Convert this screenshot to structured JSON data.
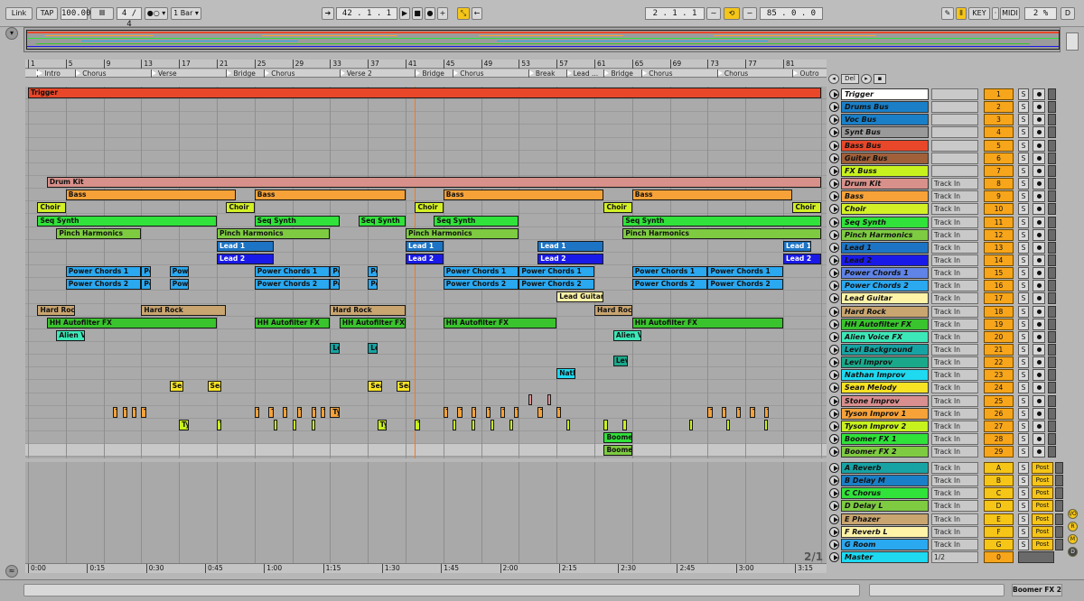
{
  "transport": {
    "link": "Link",
    "tap": "TAP",
    "tempo": "100.00",
    "sig": "4 / 4",
    "quant": "1 Bar",
    "position": "42 .   1 .   1",
    "loop_start": "2 .   1 .   1",
    "loop_len": "85 .   0 .   0",
    "key": "KEY",
    "midi": "MIDI",
    "cpu": "2 %",
    "d": "D"
  },
  "ruler": [
    {
      "label": "1",
      "bar": 1
    },
    {
      "label": "5",
      "bar": 5
    },
    {
      "label": "9",
      "bar": 9
    },
    {
      "label": "13",
      "bar": 13
    },
    {
      "label": "17",
      "bar": 17
    },
    {
      "label": "21",
      "bar": 21
    },
    {
      "label": "25",
      "bar": 25
    },
    {
      "label": "29",
      "bar": 29
    },
    {
      "label": "33",
      "bar": 33
    },
    {
      "label": "37",
      "bar": 37
    },
    {
      "label": "41",
      "bar": 41
    },
    {
      "label": "45",
      "bar": 45
    },
    {
      "label": "49",
      "bar": 49
    },
    {
      "label": "53",
      "bar": 53
    },
    {
      "label": "57",
      "bar": 57
    },
    {
      "label": "61",
      "bar": 61
    },
    {
      "label": "65",
      "bar": 65
    },
    {
      "label": "69",
      "bar": 69
    },
    {
      "label": "73",
      "bar": 73
    },
    {
      "label": "77",
      "bar": 77
    },
    {
      "label": "81",
      "bar": 81
    }
  ],
  "locators": [
    {
      "label": "Intro",
      "bar": 2
    },
    {
      "label": "Chorus",
      "bar": 6
    },
    {
      "label": "Verse",
      "bar": 14
    },
    {
      "label": "Bridge",
      "bar": 22
    },
    {
      "label": "Chorus",
      "bar": 26
    },
    {
      "label": "Verse 2",
      "bar": 34
    },
    {
      "label": "Bridge",
      "bar": 42
    },
    {
      "label": "Chorus",
      "bar": 46
    },
    {
      "label": "Break",
      "bar": 54
    },
    {
      "label": "Lead ...",
      "bar": 58
    },
    {
      "label": "Bridge",
      "bar": 62
    },
    {
      "label": "Chorus",
      "bar": 66
    },
    {
      "label": "Chorus",
      "bar": 74
    },
    {
      "label": "Outro",
      "bar": 82
    }
  ],
  "time_ticks": [
    {
      "label": "0:00",
      "bar": 1
    },
    {
      "label": "0:15",
      "bar": 7.25
    },
    {
      "label": "0:30",
      "bar": 13.5
    },
    {
      "label": "0:45",
      "bar": 19.75
    },
    {
      "label": "1:00",
      "bar": 26
    },
    {
      "label": "1:15",
      "bar": 32.25
    },
    {
      "label": "1:30",
      "bar": 38.5
    },
    {
      "label": "1:45",
      "bar": 44.75
    },
    {
      "label": "2:00",
      "bar": 51
    },
    {
      "label": "2:15",
      "bar": 57.25
    },
    {
      "label": "2:30",
      "bar": 63.5
    },
    {
      "label": "2:45",
      "bar": 69.75
    },
    {
      "label": "3:00",
      "bar": 76
    },
    {
      "label": "3:15",
      "bar": 82.25
    }
  ],
  "zoom_label": "2/1",
  "tracks": [
    {
      "name": "Trigger",
      "color": "#ffffff",
      "clip_color": "#e8472a",
      "input": "",
      "num": "1"
    },
    {
      "name": "Drums Bus",
      "color": "#1a7fc7",
      "clip_color": "#1a7fc7",
      "input": "",
      "num": "2"
    },
    {
      "name": "Voc Bus",
      "color": "#1a7fc7",
      "clip_color": "#1a7fc7",
      "input": "",
      "num": "3"
    },
    {
      "name": "Synt Bus",
      "color": "#9a9a9a",
      "clip_color": "#9a9a9a",
      "input": "",
      "num": "4"
    },
    {
      "name": "Bass Bus",
      "color": "#e8472a",
      "clip_color": "#e8472a",
      "input": "",
      "num": "5"
    },
    {
      "name": "Guitar Bus",
      "color": "#a0603a",
      "clip_color": "#a0603a",
      "input": "",
      "num": "6"
    },
    {
      "name": "FX Buss",
      "color": "#c8f21e",
      "clip_color": "#c8f21e",
      "input": "",
      "num": "7"
    },
    {
      "name": "Drum Kit",
      "color": "#d8908a",
      "clip_color": "#d8908a",
      "input": "Track In",
      "num": "8"
    },
    {
      "name": "Bass",
      "color": "#f7a239",
      "clip_color": "#f7a239",
      "input": "Track In",
      "num": "9"
    },
    {
      "name": "Choir",
      "color": "#d3f026",
      "clip_color": "#d3f026",
      "input": "Track In",
      "num": "10"
    },
    {
      "name": "Seq Synth",
      "color": "#30e23a",
      "clip_color": "#30e23a",
      "input": "Track In",
      "num": "11"
    },
    {
      "name": "Pinch Harmonics",
      "color": "#7ecb42",
      "clip_color": "#7ecb42",
      "input": "Track In",
      "num": "12"
    },
    {
      "name": "Lead 1",
      "color": "#1d74c4",
      "clip_color": "#1d74c4",
      "input": "Track In",
      "num": "13"
    },
    {
      "name": "Lead 2",
      "color": "#1a1ae8",
      "clip_color": "#1a1ae8",
      "input": "Track In",
      "num": "14"
    },
    {
      "name": "Power Chords 1",
      "color": "#5f83e6",
      "clip_color": "#2aa8f0",
      "input": "Track In",
      "num": "15"
    },
    {
      "name": "Power Chords 2",
      "color": "#2aa8f0",
      "clip_color": "#2aa8f0",
      "input": "Track In",
      "num": "16"
    },
    {
      "name": "Lead Guitar",
      "color": "#fff3a8",
      "clip_color": "#fff3a8",
      "input": "Track In",
      "num": "17"
    },
    {
      "name": "Hard Rock",
      "color": "#c9a570",
      "clip_color": "#c9a570",
      "input": "Track In",
      "num": "18"
    },
    {
      "name": "HH Autofilter FX",
      "color": "#39c42d",
      "clip_color": "#39c42d",
      "input": "Track In",
      "num": "19"
    },
    {
      "name": "Alien Voice FX",
      "color": "#3de8b8",
      "clip_color": "#3de8b8",
      "input": "Track In",
      "num": "20"
    },
    {
      "name": "Levi Background",
      "color": "#17a3a3",
      "clip_color": "#17a3a3",
      "input": "Track In",
      "num": "21"
    },
    {
      "name": "Levi Improv",
      "color": "#1aa88a",
      "clip_color": "#1aa88a",
      "input": "Track In",
      "num": "22"
    },
    {
      "name": "Nathan Improv",
      "color": "#1ed9f0",
      "clip_color": "#1ed9f0",
      "input": "Track In",
      "num": "23"
    },
    {
      "name": "Sean Melody",
      "color": "#f7e224",
      "clip_color": "#f7e224",
      "input": "Track In",
      "num": "24"
    },
    {
      "name": "Stone Improv",
      "color": "#d98f8f",
      "clip_color": "#d98f8f",
      "input": "Track In",
      "num": "25"
    },
    {
      "name": "Tyson Improv 1",
      "color": "#f7a239",
      "clip_color": "#f7a239",
      "input": "Track In",
      "num": "26"
    },
    {
      "name": "Tyson Improv 2",
      "color": "#c8f21e",
      "clip_color": "#c8f21e",
      "input": "Track In",
      "num": "27"
    },
    {
      "name": "Boomer FX 1",
      "color": "#30e23a",
      "clip_color": "#30e23a",
      "input": "Track In",
      "num": "28"
    },
    {
      "name": "Boomer FX 2",
      "color": "#7ecb42",
      "clip_color": "#7ecb42",
      "input": "Track In",
      "num": "29"
    }
  ],
  "clips": [
    {
      "t": 0,
      "s": 1,
      "e": 85,
      "n": "Trigger"
    },
    {
      "t": 7,
      "s": 3,
      "e": 85,
      "n": "Drum Kit"
    },
    {
      "t": 8,
      "s": 5,
      "e": 23,
      "n": "Bass"
    },
    {
      "t": 8,
      "s": 25,
      "e": 41,
      "n": "Bass"
    },
    {
      "t": 8,
      "s": 45,
      "e": 62,
      "n": "Bass"
    },
    {
      "t": 8,
      "s": 65,
      "e": 82,
      "n": "Bass"
    },
    {
      "t": 9,
      "s": 2,
      "e": 5,
      "n": "Choir"
    },
    {
      "t": 9,
      "s": 22,
      "e": 25,
      "n": "Choir"
    },
    {
      "t": 9,
      "s": 42,
      "e": 45,
      "n": "Choir"
    },
    {
      "t": 9,
      "s": 62,
      "e": 65,
      "n": "Choir"
    },
    {
      "t": 9,
      "s": 82,
      "e": 85,
      "n": "Choir"
    },
    {
      "t": 10,
      "s": 2,
      "e": 21,
      "n": "Seq Synth"
    },
    {
      "t": 10,
      "s": 25,
      "e": 34,
      "n": "Seq Synth"
    },
    {
      "t": 10,
      "s": 36,
      "e": 41,
      "n": "Seq Synth"
    },
    {
      "t": 10,
      "s": 44,
      "e": 53,
      "n": "Seq Synth"
    },
    {
      "t": 10,
      "s": 64,
      "e": 85,
      "n": "Seq Synth"
    },
    {
      "t": 11,
      "s": 4,
      "e": 13,
      "n": "Pinch Harmonics"
    },
    {
      "t": 11,
      "s": 21,
      "e": 33,
      "n": "Pinch Harmonics"
    },
    {
      "t": 11,
      "s": 41,
      "e": 53,
      "n": "Pinch Harmonics"
    },
    {
      "t": 11,
      "s": 64,
      "e": 85,
      "n": "Pinch Harmonics"
    },
    {
      "t": 12,
      "s": 21,
      "e": 27,
      "n": "Lead 1"
    },
    {
      "t": 12,
      "s": 41,
      "e": 45,
      "n": "Lead 1"
    },
    {
      "t": 12,
      "s": 55,
      "e": 62,
      "n": "Lead 1"
    },
    {
      "t": 12,
      "s": 81,
      "e": 84,
      "n": "Lead 1"
    },
    {
      "t": 13,
      "s": 21,
      "e": 27,
      "n": "Lead 2"
    },
    {
      "t": 13,
      "s": 41,
      "e": 45,
      "n": "Lead 2"
    },
    {
      "t": 13,
      "s": 55,
      "e": 62,
      "n": "Lead 2"
    },
    {
      "t": 13,
      "s": 81,
      "e": 85,
      "n": "Lead 2"
    },
    {
      "t": 14,
      "s": 5,
      "e": 13,
      "n": "Power Chords 1"
    },
    {
      "t": 14,
      "s": 13,
      "e": 14,
      "n": "Po"
    },
    {
      "t": 14,
      "s": 16,
      "e": 18,
      "n": "Powe"
    },
    {
      "t": 14,
      "s": 25,
      "e": 33,
      "n": "Power Chords 1"
    },
    {
      "t": 14,
      "s": 33,
      "e": 34,
      "n": "Po"
    },
    {
      "t": 14,
      "s": 37,
      "e": 38,
      "n": "Po"
    },
    {
      "t": 14,
      "s": 45,
      "e": 53,
      "n": "Power Chords 1"
    },
    {
      "t": 14,
      "s": 53,
      "e": 61,
      "n": "Power Chords 1"
    },
    {
      "t": 14,
      "s": 65,
      "e": 73,
      "n": "Power Chords 1"
    },
    {
      "t": 14,
      "s": 73,
      "e": 81,
      "n": "Power Chords 1"
    },
    {
      "t": 15,
      "s": 5,
      "e": 13,
      "n": "Power Chords 2"
    },
    {
      "t": 15,
      "s": 13,
      "e": 14,
      "n": "Po"
    },
    {
      "t": 15,
      "s": 16,
      "e": 18,
      "n": "Powe"
    },
    {
      "t": 15,
      "s": 25,
      "e": 33,
      "n": "Power Chords 2"
    },
    {
      "t": 15,
      "s": 33,
      "e": 34,
      "n": "Po"
    },
    {
      "t": 15,
      "s": 37,
      "e": 38,
      "n": "Po"
    },
    {
      "t": 15,
      "s": 45,
      "e": 53,
      "n": "Power Chords 2"
    },
    {
      "t": 15,
      "s": 53,
      "e": 61,
      "n": "Power Chords 2"
    },
    {
      "t": 15,
      "s": 65,
      "e": 73,
      "n": "Power Chords 2"
    },
    {
      "t": 15,
      "s": 73,
      "e": 81,
      "n": "Power Chords 2"
    },
    {
      "t": 16,
      "s": 57,
      "e": 62,
      "n": "Lead Guitar"
    },
    {
      "t": 17,
      "s": 2,
      "e": 6,
      "n": "Hard Rock"
    },
    {
      "t": 17,
      "s": 13,
      "e": 22,
      "n": "Hard Rock"
    },
    {
      "t": 17,
      "s": 33,
      "e": 41,
      "n": "Hard Rock"
    },
    {
      "t": 17,
      "s": 61,
      "e": 65,
      "n": "Hard Rock"
    },
    {
      "t": 18,
      "s": 3,
      "e": 21,
      "n": "HH Autofilter FX"
    },
    {
      "t": 18,
      "s": 25,
      "e": 33,
      "n": "HH Autofilter FX"
    },
    {
      "t": 18,
      "s": 34,
      "e": 41,
      "n": "HH Autofilter FX"
    },
    {
      "t": 18,
      "s": 45,
      "e": 57,
      "n": "HH Autofilter FX"
    },
    {
      "t": 18,
      "s": 65,
      "e": 81,
      "n": "HH Autofilter FX"
    },
    {
      "t": 19,
      "s": 4,
      "e": 7,
      "n": "Alien Vo"
    },
    {
      "t": 19,
      "s": 63,
      "e": 66,
      "n": "Alien Vo"
    },
    {
      "t": 20,
      "s": 33,
      "e": 34,
      "n": "Le"
    },
    {
      "t": 20,
      "s": 37,
      "e": 38,
      "n": "Le"
    },
    {
      "t": 21,
      "s": 63,
      "e": 64.5,
      "n": "Levi"
    },
    {
      "t": 22,
      "s": 57,
      "e": 59,
      "n": "Nathu"
    },
    {
      "t": 23,
      "s": 16,
      "e": 17.5,
      "n": "Sear"
    },
    {
      "t": 23,
      "s": 20,
      "e": 21.5,
      "n": "Sear"
    },
    {
      "t": 23,
      "s": 37,
      "e": 38.5,
      "n": "Sear"
    },
    {
      "t": 23,
      "s": 40,
      "e": 41.5,
      "n": "Sear"
    },
    {
      "t": 24,
      "s": 54,
      "e": 54.3,
      "n": ""
    },
    {
      "t": 24,
      "s": 56,
      "e": 56.4,
      "n": ""
    },
    {
      "t": 25,
      "s": 10,
      "e": 10.5,
      "n": "T"
    },
    {
      "t": 25,
      "s": 11,
      "e": 11.5,
      "n": "T"
    },
    {
      "t": 25,
      "s": 12,
      "e": 12.5,
      "n": "T"
    },
    {
      "t": 25,
      "s": 13,
      "e": 13.5,
      "n": "T"
    },
    {
      "t": 25,
      "s": 25,
      "e": 25.5,
      "n": "T"
    },
    {
      "t": 25,
      "s": 26.5,
      "e": 27,
      "n": "T"
    },
    {
      "t": 25,
      "s": 28,
      "e": 28.5,
      "n": "T"
    },
    {
      "t": 25,
      "s": 29.5,
      "e": 30,
      "n": "T"
    },
    {
      "t": 25,
      "s": 31,
      "e": 31.5,
      "n": "T"
    },
    {
      "t": 25,
      "s": 32,
      "e": 32.5,
      "n": "T"
    },
    {
      "t": 25,
      "s": 33,
      "e": 34,
      "n": "Ty"
    },
    {
      "t": 25,
      "s": 45,
      "e": 45.5,
      "n": "T"
    },
    {
      "t": 25,
      "s": 46.5,
      "e": 47,
      "n": "T"
    },
    {
      "t": 25,
      "s": 48,
      "e": 48.5,
      "n": "T"
    },
    {
      "t": 25,
      "s": 49.5,
      "e": 50,
      "n": "T"
    },
    {
      "t": 25,
      "s": 51,
      "e": 51.5,
      "n": "T"
    },
    {
      "t": 25,
      "s": 52.5,
      "e": 53,
      "n": "T"
    },
    {
      "t": 25,
      "s": 55,
      "e": 55.5,
      "n": "T"
    },
    {
      "t": 25,
      "s": 57,
      "e": 57.5,
      "n": "T"
    },
    {
      "t": 25,
      "s": 73,
      "e": 73.5,
      "n": "T"
    },
    {
      "t": 25,
      "s": 74.5,
      "e": 75,
      "n": "T"
    },
    {
      "t": 25,
      "s": 76,
      "e": 76.5,
      "n": "T"
    },
    {
      "t": 25,
      "s": 77.5,
      "e": 78,
      "n": "T"
    },
    {
      "t": 25,
      "s": 79,
      "e": 79.5,
      "n": "T"
    },
    {
      "t": 26,
      "s": 17,
      "e": 18,
      "n": "Ty"
    },
    {
      "t": 26,
      "s": 21,
      "e": 21.5,
      "n": "T"
    },
    {
      "t": 26,
      "s": 27,
      "e": 27.4,
      "n": ""
    },
    {
      "t": 26,
      "s": 29,
      "e": 29.4,
      "n": ""
    },
    {
      "t": 26,
      "s": 31,
      "e": 31.4,
      "n": ""
    },
    {
      "t": 26,
      "s": 38,
      "e": 39,
      "n": "Ty"
    },
    {
      "t": 26,
      "s": 42,
      "e": 42.5,
      "n": "T"
    },
    {
      "t": 26,
      "s": 46,
      "e": 46.4,
      "n": ""
    },
    {
      "t": 26,
      "s": 48,
      "e": 48.4,
      "n": ""
    },
    {
      "t": 26,
      "s": 50,
      "e": 50.4,
      "n": ""
    },
    {
      "t": 26,
      "s": 52,
      "e": 52.4,
      "n": ""
    },
    {
      "t": 26,
      "s": 58,
      "e": 58.4,
      "n": ""
    },
    {
      "t": 26,
      "s": 62,
      "e": 62.4,
      "n": ""
    },
    {
      "t": 26,
      "s": 64,
      "e": 64.4,
      "n": ""
    },
    {
      "t": 26,
      "s": 71,
      "e": 71.4,
      "n": ""
    },
    {
      "t": 26,
      "s": 75,
      "e": 75.4,
      "n": ""
    },
    {
      "t": 26,
      "s": 79,
      "e": 79.4,
      "n": ""
    },
    {
      "t": 27,
      "s": 62,
      "e": 65,
      "n": "Boomer F"
    },
    {
      "t": 28,
      "s": 62,
      "e": 65,
      "n": "Boomer F"
    }
  ],
  "returns": [
    {
      "name": "A Reverb",
      "color": "#17a3a3",
      "input": "Track In",
      "num": "A"
    },
    {
      "name": "B Delay M",
      "color": "#1a7fc7",
      "input": "Track In",
      "num": "B"
    },
    {
      "name": "C Chorus",
      "color": "#30e23a",
      "input": "Track In",
      "num": "C"
    },
    {
      "name": "D Delay L",
      "color": "#7ecb42",
      "input": "Track In",
      "num": "D"
    },
    {
      "name": "E Phazer",
      "color": "#c9a570",
      "input": "Track In",
      "num": "E"
    },
    {
      "name": "F Reverb L",
      "color": "#fff3a8",
      "input": "Track In",
      "num": "F"
    },
    {
      "name": "G Room",
      "color": "#2aa8f0",
      "input": "Track In",
      "num": "G"
    }
  ],
  "post_label": "Post",
  "master": {
    "name": "Master",
    "color": "#1ed9f0",
    "cue": "1/2",
    "num": "0"
  },
  "solo_label": "S",
  "overview_locators": "Del",
  "status": {
    "selected_track": "Boomer FX 2"
  },
  "side_buttons": [
    "I/O",
    "R",
    "M",
    "D"
  ]
}
